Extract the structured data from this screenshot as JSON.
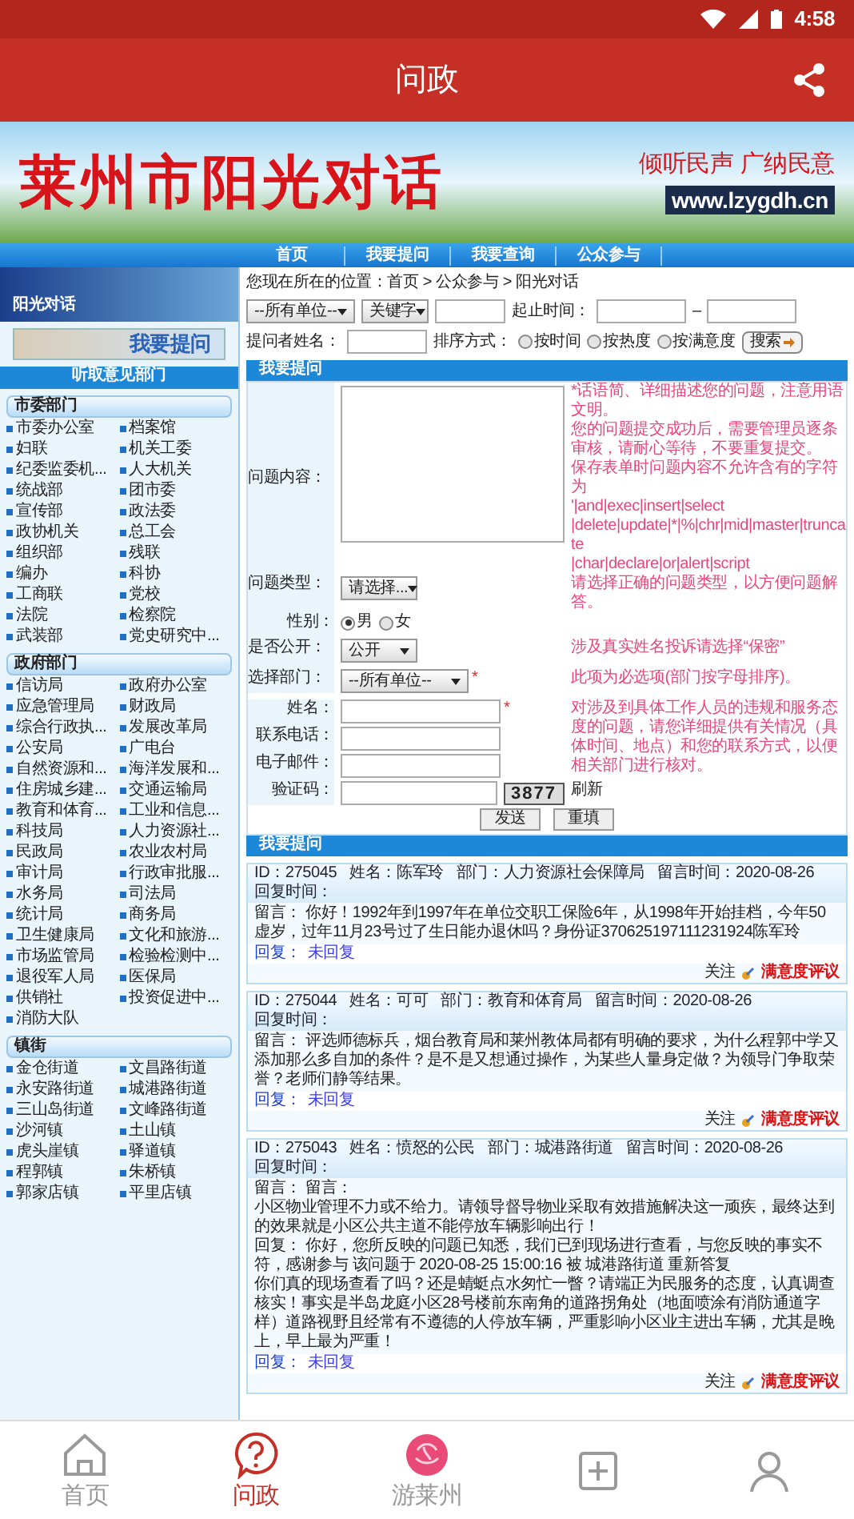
{
  "status_bar": {
    "time": "4:58"
  },
  "app_bar": {
    "title": "问政"
  },
  "banner": {
    "title": "莱州市阳光对话",
    "slogan": "倾听民声 广纳民意",
    "url": "www.lzygdh.cn"
  },
  "site_nav": [
    {
      "label": "首页"
    },
    {
      "label": "我要提问"
    },
    {
      "label": "我要查询"
    },
    {
      "label": "公众参与"
    }
  ],
  "sidebar": {
    "banner_title": "阳光对话",
    "ask_button": "我要提问",
    "heading": "听取意见部门",
    "groups": [
      {
        "title": "市委部门",
        "items": [
          "市委办公室",
          "档案馆",
          "妇联",
          "机关工委",
          "纪委监委机...",
          "人大机关",
          "统战部",
          "团市委",
          "宣传部",
          "政法委",
          "政协机关",
          "总工会",
          "组织部",
          "残联",
          "编办",
          "科协",
          "工商联",
          "党校",
          "法院",
          "检察院",
          "武装部",
          "党史研究中..."
        ]
      },
      {
        "title": "政府部门",
        "items": [
          "信访局",
          "政府办公室",
          "应急管理局",
          "财政局",
          "综合行政执...",
          "发展改革局",
          "公安局",
          "广电台",
          "自然资源和...",
          "海洋发展和...",
          "住房城乡建...",
          "交通运输局",
          "教育和体育...",
          "工业和信息...",
          "科技局",
          "人力资源社...",
          "民政局",
          "农业农村局",
          "审计局",
          "行政审批服...",
          "水务局",
          "司法局",
          "统计局",
          "商务局",
          "卫生健康局",
          "文化和旅游...",
          "市场监管局",
          "检验检测中...",
          "退役军人局",
          "医保局",
          "供销社",
          "投资促进中...",
          "消防大队"
        ]
      },
      {
        "title": "镇街",
        "items": [
          "金仓街道",
          "文昌路街道",
          "永安路街道",
          "城港路街道",
          "三山岛街道",
          "文峰路街道",
          "沙河镇",
          "土山镇",
          "虎头崖镇",
          "驿道镇",
          "程郭镇",
          "朱桥镇",
          "郭家店镇",
          "平里店镇"
        ]
      }
    ]
  },
  "search": {
    "breadcrumb": "您现在所在的位置：首页 > 公众参与 > 阳光对话",
    "unit_select": "--所有单位--",
    "keyword_select": "关键字",
    "date_label": "起止时间：",
    "date_separator": "–",
    "name_label": "提问者姓名：",
    "sort_label": "排序方式：",
    "sort_options": [
      {
        "label": "按时间",
        "selected": false
      },
      {
        "label": "按热度",
        "selected": false
      },
      {
        "label": "按满意度",
        "selected": false
      }
    ],
    "search_button": "搜索"
  },
  "form": {
    "heading": "我要提问",
    "content_label": "问题内容：",
    "content_hints": [
      "*话语简、详细描述您的问题，注意用语文明。",
      "您的问题提交成功后，需要管理员逐条审核，请耐心等待，不要重复提交。",
      "保存表单时问题内容不允许含有的字符为",
      "'|and|exec|insert|select",
      "|delete|update|*|%|chr|mid|master|truncate",
      "|char|declare|or|alert|script"
    ],
    "type_label": "问题类型：",
    "type_select": "请选择...",
    "type_hint": "请选择正确的问题类型，以方便问题解答。",
    "gender_label": "性别：",
    "gender_options": [
      {
        "label": "男",
        "selected": true
      },
      {
        "label": "女",
        "selected": false
      }
    ],
    "public_label": "是否公开：",
    "public_select": "公开",
    "public_hint": "涉及真实姓名投诉请选择“保密”",
    "dept_label": "选择部门：",
    "dept_select": "--所有单位--",
    "dept_required_mark": "*",
    "dept_hint": "此项为必选项(部门按字母排序)。",
    "contact_fields": [
      {
        "label": "姓名：",
        "required_mark": "*"
      },
      {
        "label": "联系电话："
      },
      {
        "label": "电子邮件："
      }
    ],
    "contact_hint": "对涉及到具体工作人员的违规和服务态度的问题，请您详细提供有关情况（具体时间、地点）和您的联系方式，以便相关部门进行核对。",
    "captcha_label": "验证码：",
    "captcha": "3877",
    "refresh": "刷新",
    "buttons": [
      "发送",
      "重填"
    ]
  },
  "messages": {
    "heading": "我要提问",
    "items": [
      {
        "id": "ID：275045",
        "name": "姓名：陈军玲",
        "dept": "部门：人力资源社会保障局",
        "time": "留言时间：2020-08-26",
        "reply_time": "回复时间：",
        "body": [
          "留言： 你好！1992年到1997年在单位交职工保险6年，从1998年开始挂档，今年50虚岁，过年11月23号过了生日能办退休吗？身份证370625197111231924陈军玲"
        ],
        "reply_label": "回复：",
        "reply_status": "未回复",
        "follow": "关注",
        "rate": "满意度评议"
      },
      {
        "id": "ID：275044",
        "name": "姓名：可可",
        "dept": "部门：教育和体育局",
        "time": "留言时间：2020-08-26",
        "reply_time": "回复时间：",
        "body": [
          "留言： 评选师德标兵，烟台教育局和莱州教体局都有明确的要求，为什么程郭中学又添加那么多自加的条件？是不是又想通过操作，为某些人量身定做？为领导门争取荣誉？老师们静等结果。"
        ],
        "reply_label": "回复：",
        "reply_status": "未回复",
        "follow": "关注",
        "rate": "满意度评议"
      },
      {
        "id": "ID：275043",
        "name": "姓名：愤怒的公民",
        "dept": "部门：城港路街道",
        "time": "留言时间：2020-08-26",
        "reply_time": "回复时间：",
        "body": [
          "留言： 留言：",
          "小区物业管理不力或不给力。请领导督导物业采取有效措施解决这一顽疾，最终达到的效果就是小区公共主道不能停放车辆影响出行！",
          "回复： 你好，您所反映的问题已知悉，我们已到现场进行查看，与您反映的事实不符，感谢参与 该问题于 2020-08-25 15:00:16 被 城港路街道 重新答复",
          "你们真的现场查看了吗？还是蜻蜓点水匆忙一瞥？请端正为民服务的态度，认真调查核实！事实是半岛龙庭小区28号楼前东南角的道路拐角处（地面喷涂有消防通道字样）道路视野且经常有不遵德的人停放车辆，严重影响小区业主进出车辆，尤其是晚上，早上最为严重！"
        ],
        "reply_label": "回复：",
        "reply_status": "未回复",
        "follow": "关注",
        "rate": "满意度评议"
      }
    ]
  },
  "tab_bar": [
    {
      "kind": "home",
      "label": "首页",
      "selected": false
    },
    {
      "kind": "question",
      "label": "问政",
      "selected": true
    },
    {
      "kind": "flower",
      "label": "游莱州",
      "selected": false
    },
    {
      "kind": "plus",
      "selected": false
    },
    {
      "kind": "person",
      "selected": false
    }
  ]
}
